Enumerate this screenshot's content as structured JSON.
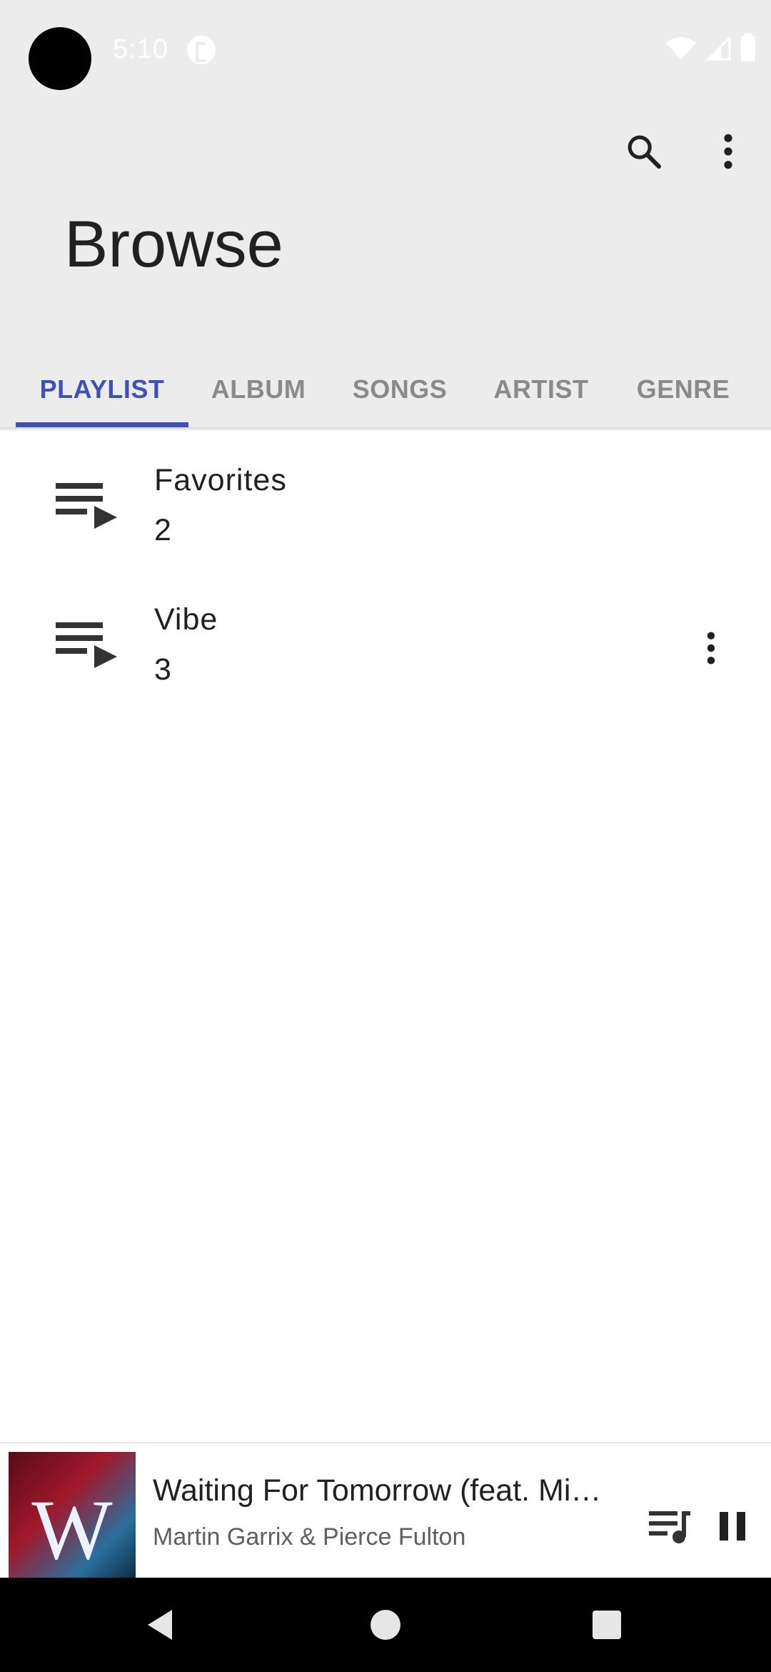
{
  "status_bar": {
    "time": "5:10"
  },
  "header": {
    "title": "Browse"
  },
  "tabs": [
    {
      "label": "PLAYLIST",
      "active": true
    },
    {
      "label": "ALBUM",
      "active": false
    },
    {
      "label": "SONGS",
      "active": false
    },
    {
      "label": "ARTIST",
      "active": false
    },
    {
      "label": "GENRE",
      "active": false
    }
  ],
  "playlists": [
    {
      "name": "Favorites",
      "count": "2"
    },
    {
      "name": "Vibe",
      "count": "3"
    }
  ],
  "now_playing": {
    "title": "Waiting For Tomorrow (feat. Mi…",
    "artist": "Martin Garrix & Pierce Fulton",
    "art_letter": "W"
  },
  "colors": {
    "accent": "#3f51b5",
    "header_bg": "#ececec"
  },
  "icons": {
    "search": "search-icon",
    "more": "more-vert-icon",
    "playlist": "playlist-play-icon",
    "queue": "queue-music-icon",
    "pause": "pause-icon"
  }
}
